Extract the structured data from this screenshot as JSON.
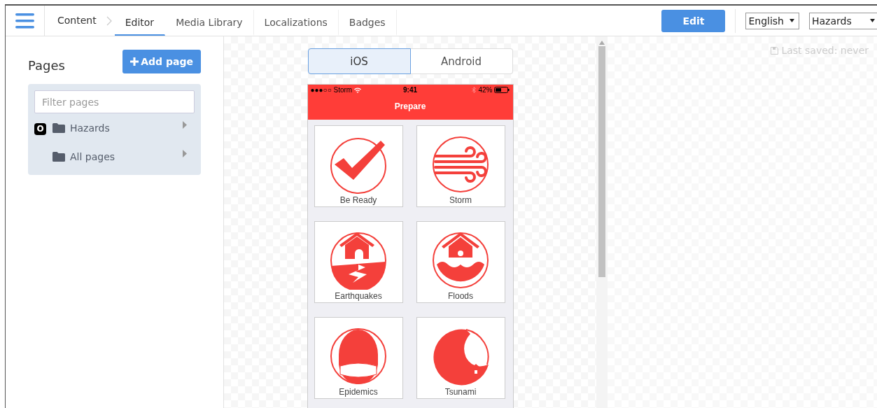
{
  "nav_items": [
    {
      "label": "Content",
      "kind": "crumb",
      "selected": false
    },
    {
      "label": "Editor",
      "kind": "tab",
      "selected": true
    },
    {
      "label": "Media Library",
      "kind": "tab",
      "selected": false
    },
    {
      "label": "Localizations",
      "kind": "tab",
      "selected": false
    },
    {
      "label": "Badges",
      "kind": "tab",
      "selected": false
    }
  ],
  "edit_button": "Edit",
  "language_select": "English",
  "section_select": "Hazards",
  "sidebar": {
    "title": "Pages",
    "add_button": "Add page",
    "filter": {
      "placeholder": "Filter pages"
    },
    "tree": [
      {
        "label": "Hazards",
        "badge": "O",
        "expanded": false
      },
      {
        "label": "All pages",
        "expanded": false
      }
    ]
  },
  "platform_tabs": [
    {
      "label": "iOS",
      "selected": true
    },
    {
      "label": "Android",
      "selected": false
    }
  ],
  "phone": {
    "carrier": "●●●○○ Storm",
    "time": "9:41",
    "battery": "42%",
    "title": "Prepare",
    "tiles": [
      {
        "label": "Be Ready",
        "kind": "check"
      },
      {
        "label": "Storm",
        "kind": "wind"
      },
      {
        "label": "Earthquakes",
        "kind": "earthquake"
      },
      {
        "label": "Floods",
        "kind": "flood"
      },
      {
        "label": "Epidemics",
        "kind": "epidemic"
      },
      {
        "label": "Tsunami",
        "kind": "tsunami"
      }
    ]
  },
  "last_saved": "Last saved: never"
}
